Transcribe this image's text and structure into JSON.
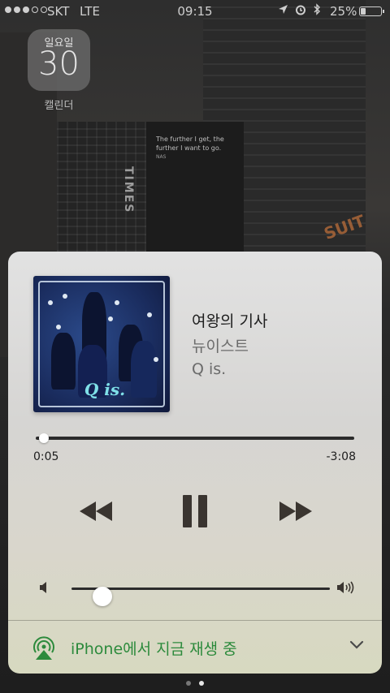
{
  "status_bar": {
    "carrier": "SKT",
    "network": "LTE",
    "time": "09:15",
    "battery": "25%",
    "battery_level": 0.25
  },
  "lock_widget": {
    "calendar_day": "일요일",
    "calendar_date": "30",
    "calendar_label": "캘린더"
  },
  "background": {
    "billboard_text": "The further I get, the further I want to go.",
    "billboard_sub": "NAS",
    "sign_text": "TIMES",
    "sign2_text": "SUIT"
  },
  "player": {
    "song": "여왕의 기사",
    "artist": "뉴이스트",
    "album": "Q is.",
    "album_art_title": "Q is.",
    "elapsed": "0:05",
    "remaining": "-3:08",
    "progress": 0.026,
    "volume": 0.12,
    "airplay_label": "iPhone에서 지금 재생 중",
    "icons": {
      "rewind": "rewind-icon",
      "pause": "pause-icon",
      "fast_forward": "fast-forward-icon",
      "volume_low": "volume-low-icon",
      "volume_high": "volume-high-icon",
      "airplay": "airplay-icon",
      "chevron": "chevron-down-icon"
    },
    "colors": {
      "airplay_green": "#2c8a3c"
    }
  },
  "pager": {
    "count": 2,
    "active": 1
  }
}
